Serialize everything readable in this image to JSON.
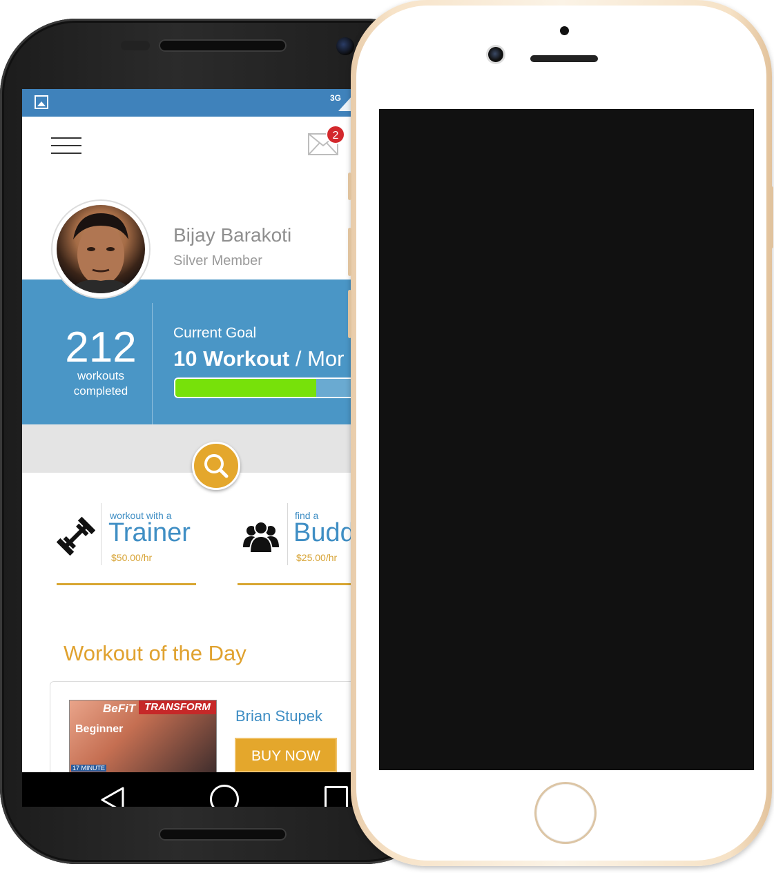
{
  "statusbar": {
    "network": "3G"
  },
  "notifications": {
    "count": "2"
  },
  "profile": {
    "name": "Bijay Barakoti",
    "tier": "Silver Member"
  },
  "stats": {
    "workouts_number": "212",
    "workouts_label_1": "workouts",
    "workouts_label_2": "completed"
  },
  "goal": {
    "title": "Current Goal",
    "value": "10 Workout",
    "separator": " / ",
    "unit": "Mor",
    "progress": 0.69
  },
  "options": [
    {
      "small": "workout with a",
      "big": "Trainer",
      "price": "$50.00/hr",
      "icon": "dumbbell-icon"
    },
    {
      "small": "find a",
      "big": "Budd",
      "price": "$25.00/hr",
      "icon": "group-icon"
    }
  ],
  "wod": {
    "title": "Workout of the Day",
    "thumb_brand": "BeFiT",
    "thumb_banner": "TRANSFORM",
    "thumb_level": "Beginner",
    "thumb_caption": "17 MINUTE",
    "author": "Brian Stupek",
    "buy_label": "BUY NOW"
  },
  "colors": {
    "status_blue": "#3f82bb",
    "panel_blue": "#4a96c6",
    "accent_gold": "#e4a72c",
    "progress_green": "#77e10a"
  }
}
